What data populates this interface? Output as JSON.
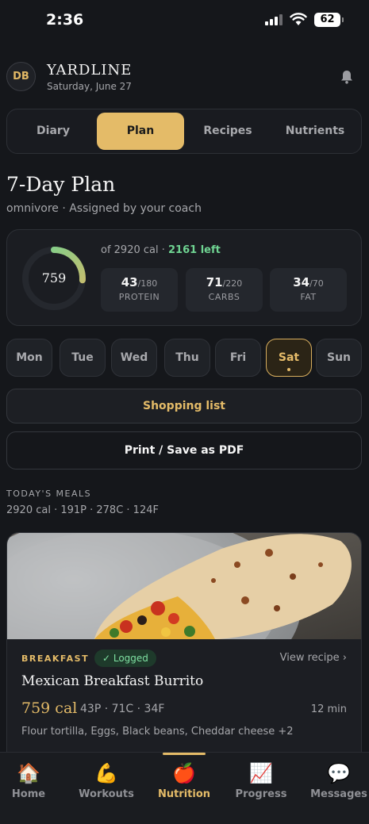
{
  "status_bar": {
    "time": "2:36",
    "battery": "62"
  },
  "header": {
    "avatar_initials": "DB",
    "brand": "YARDLINE",
    "date": "Saturday, June 27"
  },
  "tabs": [
    {
      "label": "Diary"
    },
    {
      "label": "Plan",
      "active": true
    },
    {
      "label": "Recipes"
    },
    {
      "label": "Nutrients"
    }
  ],
  "plan": {
    "title": "7-Day Plan",
    "subtitle": "omnivore · Assigned by your coach"
  },
  "summary": {
    "calories_eaten": "759",
    "calories_of": "of 2920 cal",
    "calories_left": "2161 left",
    "calorie_fraction": 0.26,
    "macros": [
      {
        "value": "43",
        "target": "/180",
        "label": "PROTEIN"
      },
      {
        "value": "71",
        "target": "/220",
        "label": "CARBS"
      },
      {
        "value": "34",
        "target": "/70",
        "label": "FAT"
      }
    ]
  },
  "days": [
    {
      "label": "Mon"
    },
    {
      "label": "Tue"
    },
    {
      "label": "Wed"
    },
    {
      "label": "Thu"
    },
    {
      "label": "Fri"
    },
    {
      "label": "Sat",
      "active": true
    },
    {
      "label": "Sun"
    }
  ],
  "buttons": {
    "shopping": "Shopping list",
    "print": "Print / Save as PDF"
  },
  "meals": {
    "section_label": "TODAY'S MEALS",
    "totals": "2920 cal · 191P · 278C · 124F"
  },
  "meal": {
    "type": "BREAKFAST",
    "status": "✓ Logged",
    "view_link": "View recipe ›",
    "name": "Mexican Breakfast Burrito",
    "calories": "759 cal",
    "macros": "43P · 71C · 34F",
    "time": "12 min",
    "ingredients": "Flour tortilla, Eggs, Black beans, Cheddar cheese +2"
  },
  "nav": [
    {
      "label": "Home",
      "icon": "house-icon",
      "glyph": "🏠"
    },
    {
      "label": "Workouts",
      "icon": "flexed-bicep-icon",
      "glyph": "💪"
    },
    {
      "label": "Nutrition",
      "icon": "apple-icon",
      "glyph": "🍎",
      "active": true
    },
    {
      "label": "Progress",
      "icon": "chart-icon",
      "glyph": "📈"
    },
    {
      "label": "Messages",
      "icon": "speech-bubble-icon",
      "glyph": "💬"
    }
  ],
  "colors": {
    "accent": "#e4bb68",
    "success": "#6fd492",
    "background": "#15171b"
  }
}
